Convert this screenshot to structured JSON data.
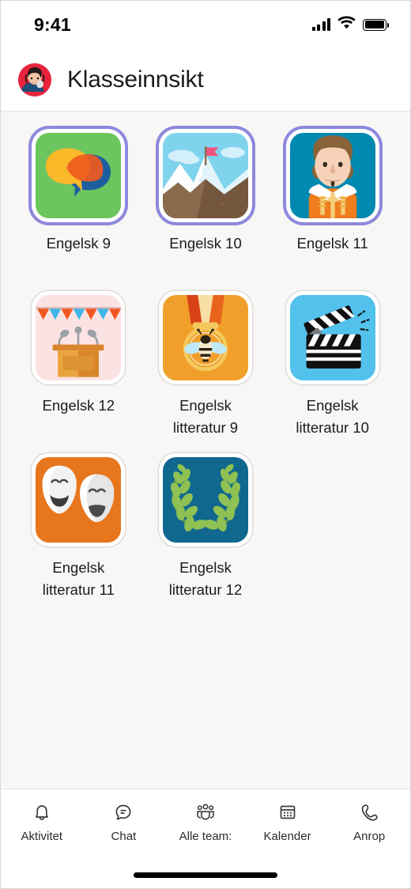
{
  "status_bar": {
    "time": "9:41",
    "signal_icon": "cellular-signal-icon",
    "wifi_icon": "wifi-icon",
    "battery_icon": "battery-full-icon"
  },
  "header": {
    "title": "Klasseinnsikt",
    "avatar_name": "user-avatar"
  },
  "teams": [
    {
      "label": "Engelsk 9",
      "icon": "speech-bubbles-icon",
      "ring": "purple",
      "bg": "#6dc55f"
    },
    {
      "label": "Engelsk 10",
      "icon": "mountain-flag-icon",
      "ring": "purple",
      "bg": "#7fd3ec"
    },
    {
      "label": "Engelsk 11",
      "icon": "shakespeare-icon",
      "ring": "purple",
      "bg": "#0089b0"
    },
    {
      "label": "Engelsk 12",
      "icon": "podium-icon",
      "ring": "plain",
      "bg": "#fbe3e3"
    },
    {
      "label": "Engelsk litteratur 9",
      "icon": "spelling-bee-medal-icon",
      "ring": "plain",
      "bg": "#f0a02a"
    },
    {
      "label": "Engelsk litteratur 10",
      "icon": "clapperboard-icon",
      "ring": "plain",
      "bg": "#52c1ec"
    },
    {
      "label": "Engelsk litteratur 11",
      "icon": "theater-masks-icon",
      "ring": "plain",
      "bg": "#e8761d"
    },
    {
      "label": "Engelsk litteratur 12",
      "icon": "laurel-wreath-icon",
      "ring": "plain",
      "bg": "#10688e"
    }
  ],
  "tab_bar": {
    "items": [
      {
        "label": "Aktivitet",
        "icon": "bell-icon"
      },
      {
        "label": "Chat",
        "icon": "chat-bubble-icon"
      },
      {
        "label": "Alle team:",
        "icon": "people-team-icon"
      },
      {
        "label": "Kalender",
        "icon": "calendar-icon"
      },
      {
        "label": "Anrop",
        "icon": "phone-icon"
      }
    ]
  },
  "colors": {
    "page_background": "#f8f7f5",
    "surface": "#ffffff",
    "ring_purple": "#8e88dd",
    "ring_plain": "#dedcda",
    "text_primary": "#1b1b1b"
  }
}
